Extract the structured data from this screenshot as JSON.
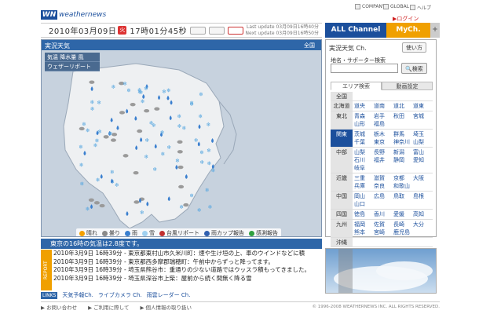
{
  "brand": {
    "logo_mark": "WN",
    "wordmark": "weathernews"
  },
  "top_links": {
    "company": "COMPANY",
    "global": "GLOBAL",
    "help": "ヘルプ",
    "login": "ログイン"
  },
  "datebar": {
    "clock_prefix": "2010年03月09日",
    "weekday": "火",
    "time": "17時01分45秒",
    "mini1": "",
    "mini2": "",
    "mini3": "",
    "last_update": "Last update 03月09日16時40分",
    "next_update": "Next update 03月09日16時50分"
  },
  "channel_tabs": {
    "all": "ALL Channel",
    "my": "MyCh.",
    "plus": "+"
  },
  "map": {
    "title": "実況天気",
    "scope": "全国",
    "menu": [
      "気温 降水量 風",
      "ウェザーリポート"
    ],
    "legend": [
      {
        "label": "晴れ",
        "color": "#f4a000"
      },
      {
        "label": "曇り",
        "color": "#8a8a8a"
      },
      {
        "label": "雨",
        "color": "#3a7fcf"
      },
      {
        "label": "雪",
        "color": "#9fd0f0"
      },
      {
        "label": "台風リポート",
        "color": "#c03030"
      },
      {
        "label": "雨カップ報告",
        "color": "#3060b0"
      },
      {
        "label": "感測報告",
        "color": "#30a040"
      }
    ]
  },
  "news": {
    "headline": "東京の16時の気温は2.8度です。",
    "report_label": "REPORT",
    "items": [
      "2010年3月9日 16時39分 - 東京都東村山市久米川町：煙や生け垣の上、車のウインドなどに積",
      "2010年3月9日 16時39分 - 東京都西多摩郡瑞穂町：午前中からずっと降ってます。",
      "2010年3月9日 16時39分 - 埼玉県熊谷市：重通りの少ない道路ではウッスラ積もってきました。",
      "2010年3月9日 16時39分 - 埼玉県深谷市上柴：屋前から続く間無く降る雪"
    ]
  },
  "link_bar": {
    "badge": "LINKS",
    "items": [
      "天気予報Ch.",
      "ライブカメラ Ch.",
      "雨雲レーダー Ch."
    ]
  },
  "right_panel": {
    "title": "実況天気 Ch.",
    "howto": "使い方",
    "search_label": "地名・サポーター検索",
    "search_button": "検索",
    "search_value": "",
    "tabs": [
      "エリア検索",
      "動画設定"
    ],
    "regions": [
      {
        "name": "全国",
        "active": false,
        "prefs": []
      },
      {
        "name": "北海道",
        "active": false,
        "prefs": [
          "道央",
          "道南",
          "道北",
          "道東"
        ]
      },
      {
        "name": "東北",
        "active": false,
        "prefs": [
          "青森",
          "岩手",
          "秋田",
          "宮城",
          "山形",
          "福島"
        ]
      },
      {
        "name": "関東",
        "active": true,
        "prefs": [
          "茨城",
          "栃木",
          "群馬",
          "埼玉",
          "千葉",
          "東京",
          "神奈川",
          "山梨"
        ]
      },
      {
        "name": "中部",
        "active": false,
        "prefs": [
          "山梨",
          "長野",
          "新潟",
          "富山",
          "石川",
          "福井",
          "静岡",
          "愛知",
          "岐阜"
        ]
      },
      {
        "name": "近畿",
        "active": false,
        "prefs": [
          "三重",
          "滋賀",
          "京都",
          "大阪",
          "兵庫",
          "奈良",
          "和歌山"
        ]
      },
      {
        "name": "中国",
        "active": false,
        "prefs": [
          "岡山",
          "広島",
          "鳥取",
          "島根",
          "山口"
        ]
      },
      {
        "name": "四国",
        "active": false,
        "prefs": [
          "徳島",
          "香川",
          "愛媛",
          "高知"
        ]
      },
      {
        "name": "九州",
        "active": false,
        "prefs": [
          "福岡",
          "佐賀",
          "長崎",
          "大分",
          "熊本",
          "宮崎",
          "鹿児島"
        ]
      },
      {
        "name": "沖縄",
        "active": false,
        "prefs": []
      }
    ]
  },
  "footer": {
    "links": [
      "お問い合わせ",
      "ご利用に際して",
      "個人情報の取り扱い"
    ],
    "copyright": "© 1996-2008 WEATHERNEWS INC. ALL RIGHTS RESERVED."
  }
}
